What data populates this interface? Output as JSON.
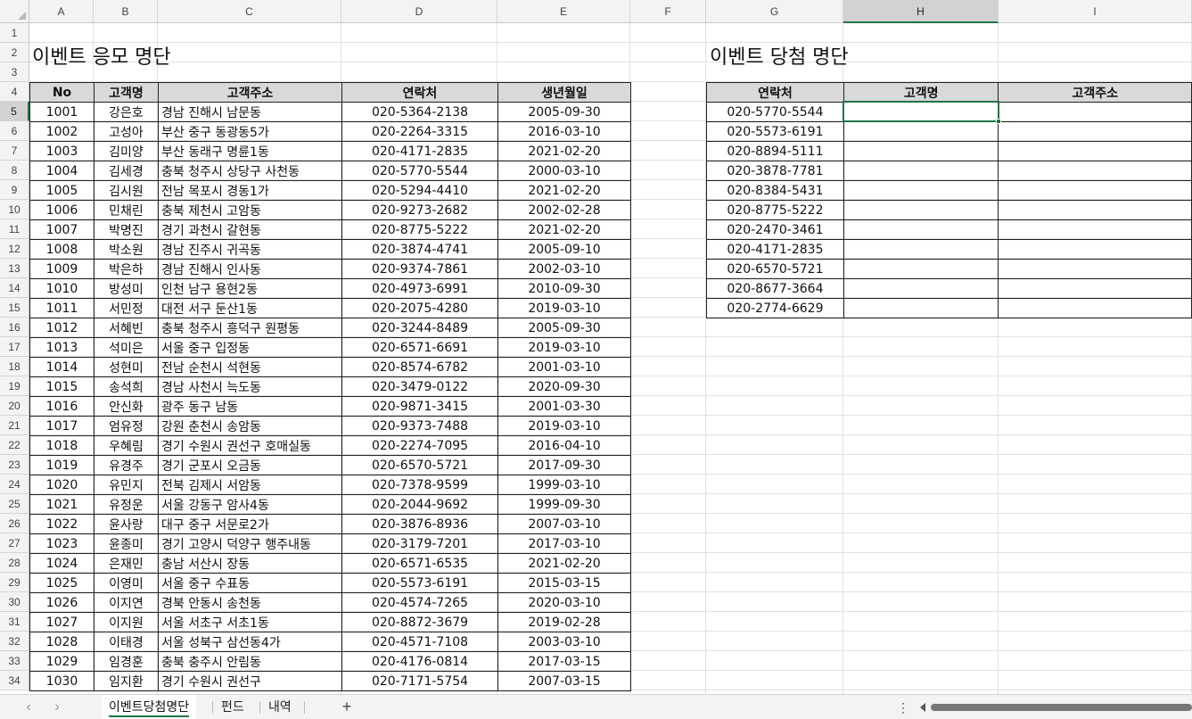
{
  "columns": [
    "A",
    "B",
    "C",
    "D",
    "E",
    "F",
    "G",
    "H",
    "I"
  ],
  "selected_column": "H",
  "selected_row": 5,
  "rows": [
    1,
    2,
    3,
    4,
    5,
    6,
    7,
    8,
    9,
    10,
    11,
    12,
    13,
    14,
    15,
    16,
    17,
    18,
    19,
    20,
    21,
    22,
    23,
    24,
    25,
    26,
    27,
    28,
    29,
    30,
    31,
    32,
    33,
    34
  ],
  "left_title": "이벤트 응모 명단",
  "right_title": "이벤트 당첨 명단",
  "left_table": {
    "headers": [
      "No",
      "고객명",
      "고객주소",
      "연락처",
      "생년월일"
    ],
    "rows": [
      [
        "1001",
        "강은호",
        "경남 진해시 남문동",
        "020-5364-2138",
        "2005-09-30"
      ],
      [
        "1002",
        "고성아",
        "부산 중구 동광동5가",
        "020-2264-3315",
        "2016-03-10"
      ],
      [
        "1003",
        "김미양",
        "부산 동래구 명륜1동",
        "020-4171-2835",
        "2021-02-20"
      ],
      [
        "1004",
        "김세경",
        "충북 청주시 상당구 사천동",
        "020-5770-5544",
        "2000-03-10"
      ],
      [
        "1005",
        "김시원",
        "전남 목포시 경동1가",
        "020-5294-4410",
        "2021-02-20"
      ],
      [
        "1006",
        "민채린",
        "충북 제천시 고암동",
        "020-9273-2682",
        "2002-02-28"
      ],
      [
        "1007",
        "박명진",
        "경기 과천시 갈현동",
        "020-8775-5222",
        "2021-02-20"
      ],
      [
        "1008",
        "박소원",
        "경남 진주시 귀곡동",
        "020-3874-4741",
        "2005-09-10"
      ],
      [
        "1009",
        "박은하",
        "경남 진해시 인사동",
        "020-9374-7861",
        "2002-03-10"
      ],
      [
        "1010",
        "방성미",
        "인천 남구 용현2동",
        "020-4973-6991",
        "2010-09-30"
      ],
      [
        "1011",
        "서민정",
        "대전 서구 둔산1동",
        "020-2075-4280",
        "2019-03-10"
      ],
      [
        "1012",
        "서혜빈",
        "충북 청주시 흥덕구 원평동",
        "020-3244-8489",
        "2005-09-30"
      ],
      [
        "1013",
        "석미은",
        "서울 중구 입정동",
        "020-6571-6691",
        "2019-03-10"
      ],
      [
        "1014",
        "성현미",
        "전남 순천시 석현동",
        "020-8574-6782",
        "2001-03-10"
      ],
      [
        "1015",
        "송석희",
        "경남 사천시 늑도동",
        "020-3479-0122",
        "2020-09-30"
      ],
      [
        "1016",
        "안신화",
        "광주 동구 남동",
        "020-9871-3415",
        "2001-03-30"
      ],
      [
        "1017",
        "엄유정",
        "강원 춘천시 송암동",
        "020-9373-7488",
        "2019-03-10"
      ],
      [
        "1018",
        "우혜림",
        "경기 수원시 권선구 호매실동",
        "020-2274-7095",
        "2016-04-10"
      ],
      [
        "1019",
        "유경주",
        "경기 군포시 오금동",
        "020-6570-5721",
        "2017-09-30"
      ],
      [
        "1020",
        "유민지",
        "전북 김제시 서암동",
        "020-7378-9599",
        "1999-03-10"
      ],
      [
        "1021",
        "유정운",
        "서울 강동구 암사4동",
        "020-2044-9692",
        "1999-09-30"
      ],
      [
        "1022",
        "윤사랑",
        "대구 중구 서문로2가",
        "020-3876-8936",
        "2007-03-10"
      ],
      [
        "1023",
        "윤종미",
        "경기 고양시 덕양구 행주내동",
        "020-3179-7201",
        "2017-03-10"
      ],
      [
        "1024",
        "은재민",
        "충남 서산시 장동",
        "020-6571-6535",
        "2021-02-20"
      ],
      [
        "1025",
        "이영미",
        "서울 중구 수표동",
        "020-5573-6191",
        "2015-03-15"
      ],
      [
        "1026",
        "이지연",
        "경북 안동시 송천동",
        "020-4574-7265",
        "2020-03-10"
      ],
      [
        "1027",
        "이지원",
        "서울 서초구 서초1동",
        "020-8872-3679",
        "2019-02-28"
      ],
      [
        "1028",
        "이태경",
        "서울 성북구 삼선동4가",
        "020-4571-7108",
        "2003-03-10"
      ],
      [
        "1029",
        "임경훈",
        "충북 충주시 안림동",
        "020-4176-0814",
        "2017-03-15"
      ],
      [
        "1030",
        "임지환",
        "경기 수원시 권선구",
        "020-7171-5754",
        "2007-03-15"
      ]
    ]
  },
  "right_table": {
    "headers": [
      "연락처",
      "고객명",
      "고객주소"
    ],
    "rows": [
      [
        "020-5770-5544",
        "",
        ""
      ],
      [
        "020-5573-6191",
        "",
        ""
      ],
      [
        "020-8894-5111",
        "",
        ""
      ],
      [
        "020-3878-7781",
        "",
        ""
      ],
      [
        "020-8384-5431",
        "",
        ""
      ],
      [
        "020-8775-5222",
        "",
        ""
      ],
      [
        "020-2470-3461",
        "",
        ""
      ],
      [
        "020-4171-2835",
        "",
        ""
      ],
      [
        "020-6570-5721",
        "",
        ""
      ],
      [
        "020-8677-3664",
        "",
        ""
      ],
      [
        "020-2774-6629",
        "",
        ""
      ]
    ]
  },
  "sheet_tabs": [
    {
      "label": "이벤트당첨명단",
      "active": true
    },
    {
      "label": "펀드",
      "active": false
    },
    {
      "label": "내역",
      "active": false
    }
  ],
  "add_sheet_label": "+",
  "more_options_label": "⋮",
  "nav_prev_icon": "chevron-left-icon",
  "nav_next_icon": "chevron-right-icon",
  "accent_color": "#217346"
}
